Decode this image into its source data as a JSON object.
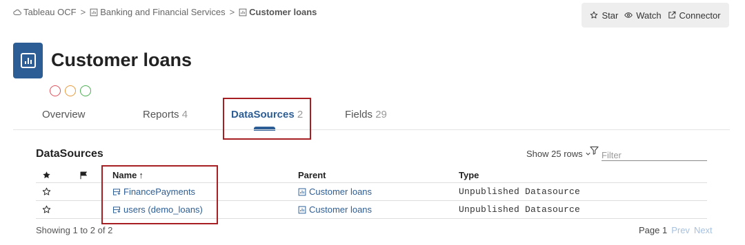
{
  "breadcrumb": {
    "items": [
      {
        "label": "Tableau OCF"
      },
      {
        "label": "Banking and Financial Services"
      },
      {
        "label": "Customer loans"
      }
    ],
    "separator": ">"
  },
  "actions": {
    "star": "Star",
    "watch": "Watch",
    "connector": "Connector"
  },
  "page": {
    "title": "Customer loans",
    "status_colors": [
      "#e0505b",
      "#e89a3a",
      "#4caf50"
    ]
  },
  "tabs": [
    {
      "label": "Overview",
      "count": ""
    },
    {
      "label": "Reports",
      "count": "4"
    },
    {
      "label": "DataSources",
      "count": "2"
    },
    {
      "label": "Fields",
      "count": "29"
    }
  ],
  "section": {
    "title": "DataSources",
    "show_rows": "Show 25 rows",
    "filter_placeholder": "Filter"
  },
  "table": {
    "headers": {
      "name": "Name",
      "sort_arrow": "↑",
      "parent": "Parent",
      "type": "Type"
    },
    "rows": [
      {
        "name": "FinancePayments",
        "parent": "Customer loans",
        "type": "Unpublished Datasource"
      },
      {
        "name": "users (demo_loans)",
        "parent": "Customer loans",
        "type": "Unpublished Datasource"
      }
    ]
  },
  "footer": {
    "showing": "Showing 1 to 2 of 2",
    "page": "Page 1",
    "prev": "Prev",
    "next": "Next"
  },
  "colors": {
    "accent": "#2c5d94",
    "highlight": "#a61e22"
  }
}
